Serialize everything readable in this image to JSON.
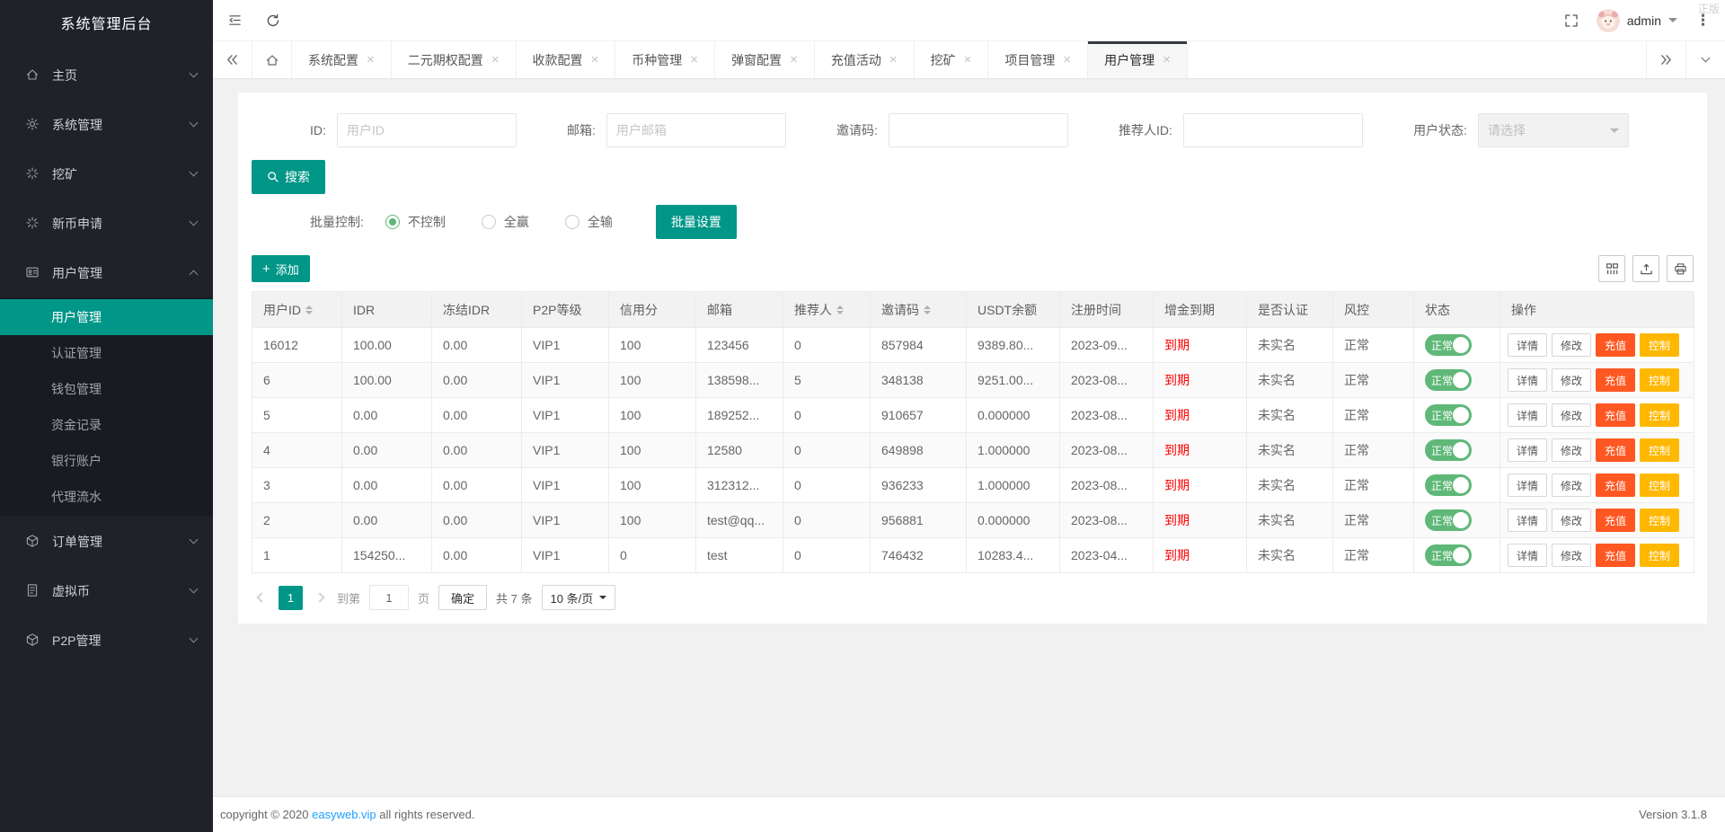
{
  "app": {
    "watermark": "正版",
    "topbar": {
      "user_name": "admin"
    },
    "footer": {
      "copyright_prefix": "copyright © 2020",
      "copyright_link": "easyweb.vip",
      "copyright_suffix": "all rights reserved.",
      "version": "Version 3.1.8"
    }
  },
  "colors": {
    "accent": "#009688",
    "toggle_green": "#5FB878",
    "danger": "#FF5722",
    "warning": "#FFB800",
    "expired_text": "#FF0000"
  },
  "sidebar": {
    "title": "系统管理后台",
    "items": [
      {
        "label": "主页",
        "icon": "home-icon"
      },
      {
        "label": "系统管理",
        "icon": "gear-icon"
      },
      {
        "label": "挖矿",
        "icon": "mining-icon"
      },
      {
        "label": "新币申请",
        "icon": "new-coin-icon"
      },
      {
        "label": "用户管理",
        "icon": "users-icon",
        "expanded": true,
        "children": [
          {
            "label": "用户管理",
            "active": true
          },
          {
            "label": "认证管理"
          },
          {
            "label": "钱包管理"
          },
          {
            "label": "资金记录"
          },
          {
            "label": "银行账户"
          },
          {
            "label": "代理流水"
          }
        ]
      },
      {
        "label": "订单管理",
        "icon": "orders-icon"
      },
      {
        "label": "虚拟币",
        "icon": "virtual-coin-icon"
      },
      {
        "label": "P2P管理",
        "icon": "p2p-icon"
      }
    ]
  },
  "tabbar": {
    "tabs": [
      {
        "label": "系统配置"
      },
      {
        "label": "二元期权配置"
      },
      {
        "label": "收款配置"
      },
      {
        "label": "币种管理"
      },
      {
        "label": "弹窗配置"
      },
      {
        "label": "充值活动"
      },
      {
        "label": "挖矿"
      },
      {
        "label": "项目管理"
      },
      {
        "label": "用户管理",
        "active": true
      }
    ]
  },
  "search": {
    "fields": [
      {
        "label": "ID:",
        "placeholder": "用户ID"
      },
      {
        "label": "邮箱:",
        "placeholder": "用户邮箱"
      },
      {
        "label": "邀请码:",
        "placeholder": ""
      },
      {
        "label": "推荐人ID:",
        "placeholder": ""
      }
    ],
    "status_select": {
      "label": "用户状态:",
      "placeholder": "请选择"
    },
    "search_button_label": "搜索",
    "batch": {
      "label": "批量控制:",
      "options": [
        "不控制",
        "全赢",
        "全输"
      ],
      "selected": "不控制",
      "apply_button_label": "批量设置"
    }
  },
  "table": {
    "add_button_label": "添加",
    "toolbar_icons": [
      "columns-icon",
      "export-icon",
      "print-icon"
    ],
    "columns": [
      {
        "label": "用户ID",
        "sortable": true
      },
      {
        "label": "IDR"
      },
      {
        "label": "冻结IDR"
      },
      {
        "label": "P2P等级"
      },
      {
        "label": "信用分"
      },
      {
        "label": "邮箱"
      },
      {
        "label": "推荐人",
        "sortable": true
      },
      {
        "label": "邀请码",
        "sortable": true
      },
      {
        "label": "USDT余额"
      },
      {
        "label": "注册时间"
      },
      {
        "label": "增金到期"
      },
      {
        "label": "是否认证"
      },
      {
        "label": "风控"
      },
      {
        "label": "状态"
      },
      {
        "label": "操作"
      }
    ],
    "op_buttons": [
      "详情",
      "修改",
      "充值",
      "控制"
    ],
    "rows": [
      [
        "16012",
        "100.00",
        "0.00",
        "VIP1",
        "100",
        "123456",
        "0",
        "857984",
        "9389.80...",
        "2023-09...",
        "到期",
        "未实名",
        "正常",
        "正常"
      ],
      [
        "6",
        "100.00",
        "0.00",
        "VIP1",
        "100",
        "138598...",
        "5",
        "348138",
        "9251.00...",
        "2023-08...",
        "到期",
        "未实名",
        "正常",
        "正常"
      ],
      [
        "5",
        "0.00",
        "0.00",
        "VIP1",
        "100",
        "189252...",
        "0",
        "910657",
        "0.000000",
        "2023-08...",
        "到期",
        "未实名",
        "正常",
        "正常"
      ],
      [
        "4",
        "0.00",
        "0.00",
        "VIP1",
        "100",
        "12580",
        "0",
        "649898",
        "1.000000",
        "2023-08...",
        "到期",
        "未实名",
        "正常",
        "正常"
      ],
      [
        "3",
        "0.00",
        "0.00",
        "VIP1",
        "100",
        "312312...",
        "0",
        "936233",
        "1.000000",
        "2023-08...",
        "到期",
        "未实名",
        "正常",
        "正常"
      ],
      [
        "2",
        "0.00",
        "0.00",
        "VIP1",
        "100",
        "test@qq...",
        "0",
        "956881",
        "0.000000",
        "2023-08...",
        "到期",
        "未实名",
        "正常",
        "正常"
      ],
      [
        "1",
        "154250...",
        "0.00",
        "VIP1",
        "0",
        "test",
        "0",
        "746432",
        "10283.4...",
        "2023-04...",
        "到期",
        "未实名",
        "正常",
        "正常"
      ]
    ]
  },
  "pagination": {
    "current_page": "1",
    "goto_label": "到第",
    "page_input_value": "1",
    "page_unit_label": "页",
    "confirm_label": "确定",
    "total_label": "共 7 条",
    "page_size_label": "10 条/页"
  }
}
